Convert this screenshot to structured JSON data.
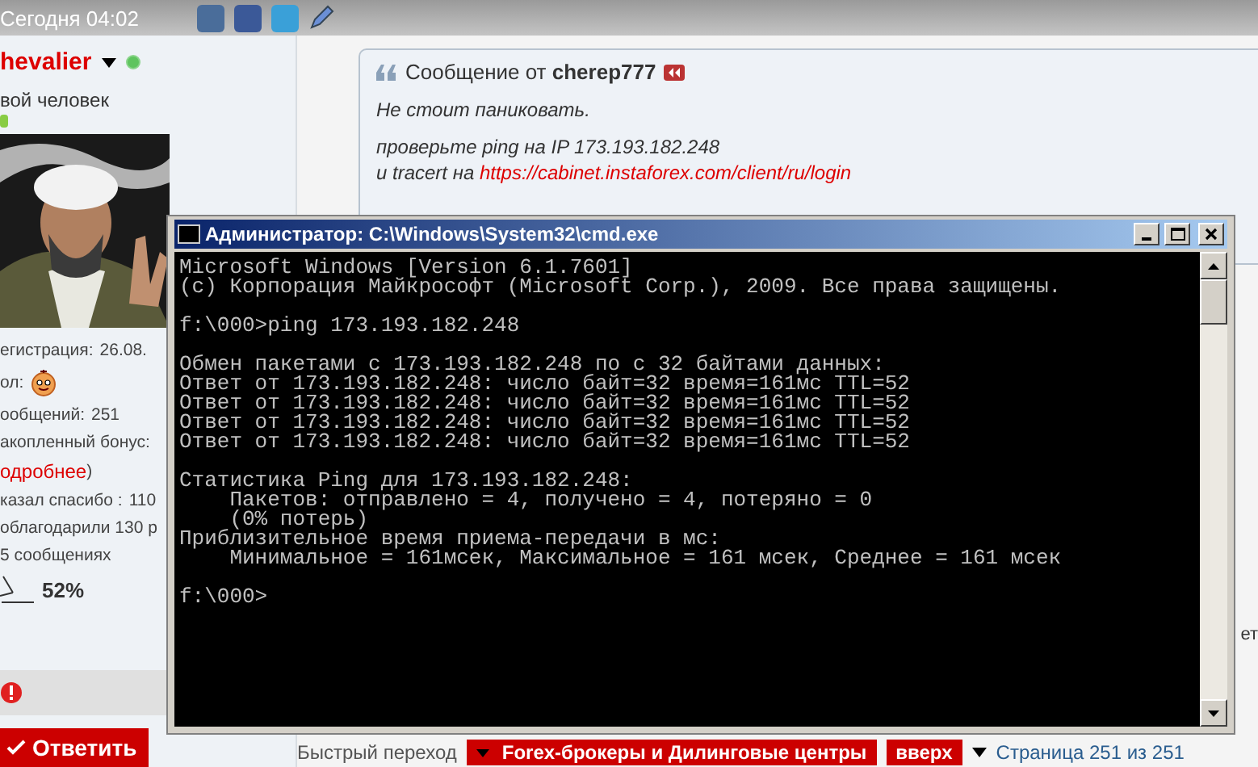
{
  "top_bar": {
    "time": "Сегодня 04:02"
  },
  "user": {
    "name": "hevalier",
    "online": true,
    "rank": "вой человек",
    "stats": [
      {
        "kind": "pair",
        "label": "егистрация:",
        "value": "26.08."
      },
      {
        "kind": "icon",
        "label": "ол:"
      },
      {
        "kind": "pair",
        "label": "ообщений:",
        "value": "251"
      },
      {
        "kind": "text",
        "text": "акопленный бонус:"
      },
      {
        "kind": "link",
        "link": "одробнее",
        "after": ")"
      },
      {
        "kind": "pair",
        "label": "казал спасибо :",
        "value": "110"
      },
      {
        "kind": "text",
        "text": "облагодарили 130 р"
      },
      {
        "kind": "text",
        "text": "5 сообщениях"
      }
    ],
    "rating": "52%"
  },
  "reply_button": "Ответить",
  "message": {
    "header": "Сообщение от **cherep777**",
    "paragraphs": [
      {
        "lines": [
          {
            "text": "Не стоит паниковать."
          }
        ]
      },
      {
        "lines": [
          {
            "text": "проверьте ping на IP 173.193.182.248"
          },
          {
            "text": "и tracert на ",
            "link": "https://cabinet.instaforex.com/client/ru/login"
          }
        ]
      }
    ]
  },
  "edge_text": "ет",
  "bottom_bar": {
    "label": "Быстрый переход",
    "forum": "Forex-брокеры и Дилинговые центры",
    "top": "вверх",
    "pages": "Страница 251 из 251"
  },
  "cmd": {
    "title": "Администратор: C:\\Windows\\System32\\cmd.exe",
    "blocks": [
      [
        "Microsoft Windows [Version 6.1.7601]",
        "(c) Корпорация Майкрософт (Microsoft Corp.), 2009. Все права защищены."
      ],
      [
        "f:\\000>ping 173.193.182.248"
      ],
      [
        "Обмен пакетами с 173.193.182.248 по с 32 байтами данных:",
        "Ответ от 173.193.182.248: число байт=32 время=161мс TTL=52",
        "Ответ от 173.193.182.248: число байт=32 время=161мс TTL=52",
        "Ответ от 173.193.182.248: число байт=32 время=161мс TTL=52",
        "Ответ от 173.193.182.248: число байт=32 время=161мс TTL=52"
      ],
      [
        "Статистика Ping для 173.193.182.248:",
        "    Пакетов: отправлено = 4, получено = 4, потеряно = 0",
        "    (0% потерь)",
        "Приблизительное время приема-передачи в мс:",
        "    Минимальное = 161мсек, Максимальное = 161 мсек, Среднее = 161 мсек"
      ],
      [
        "f:\\000>"
      ]
    ]
  }
}
